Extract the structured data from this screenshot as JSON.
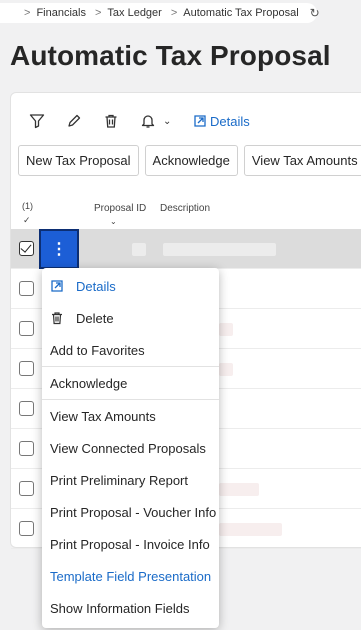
{
  "breadcrumb": {
    "items": [
      "Financials",
      "Tax Ledger",
      "Automatic Tax Proposal"
    ],
    "separator": ">"
  },
  "page": {
    "title": "Automatic Tax Proposal"
  },
  "toolbar": {
    "icons": [
      "filter-icon",
      "edit-icon",
      "delete-icon",
      "bell-icon",
      "chevron-down-icon"
    ],
    "details_label": "Details"
  },
  "actions": [
    "New Tax Proposal",
    "Acknowledge",
    "View Tax Amounts"
  ],
  "table": {
    "selected_count": "(1)",
    "columns": [
      "Proposal ID",
      "Description"
    ],
    "row_count": 8
  },
  "context_menu": {
    "items": [
      {
        "label": "Details",
        "style": "link",
        "icon": "open-external-icon"
      },
      {
        "label": "Delete",
        "style": "normal",
        "icon": "trash-icon"
      },
      {
        "label": "Add to Favorites",
        "style": "normal"
      },
      {
        "label": "Acknowledge",
        "style": "normal"
      },
      {
        "label": "View Tax Amounts",
        "style": "normal"
      },
      {
        "label": "View Connected Proposals",
        "style": "normal"
      },
      {
        "label": "Print Preliminary Report",
        "style": "normal"
      },
      {
        "label": "Print Proposal - Voucher Info",
        "style": "normal"
      },
      {
        "label": "Print Proposal - Invoice Info",
        "style": "normal"
      },
      {
        "label": "Template Field Presentation",
        "style": "link"
      },
      {
        "label": "Show Information Fields",
        "style": "normal"
      }
    ]
  },
  "colors": {
    "accent": "#1a6bc8",
    "selected_button": "#1c5ed6"
  }
}
